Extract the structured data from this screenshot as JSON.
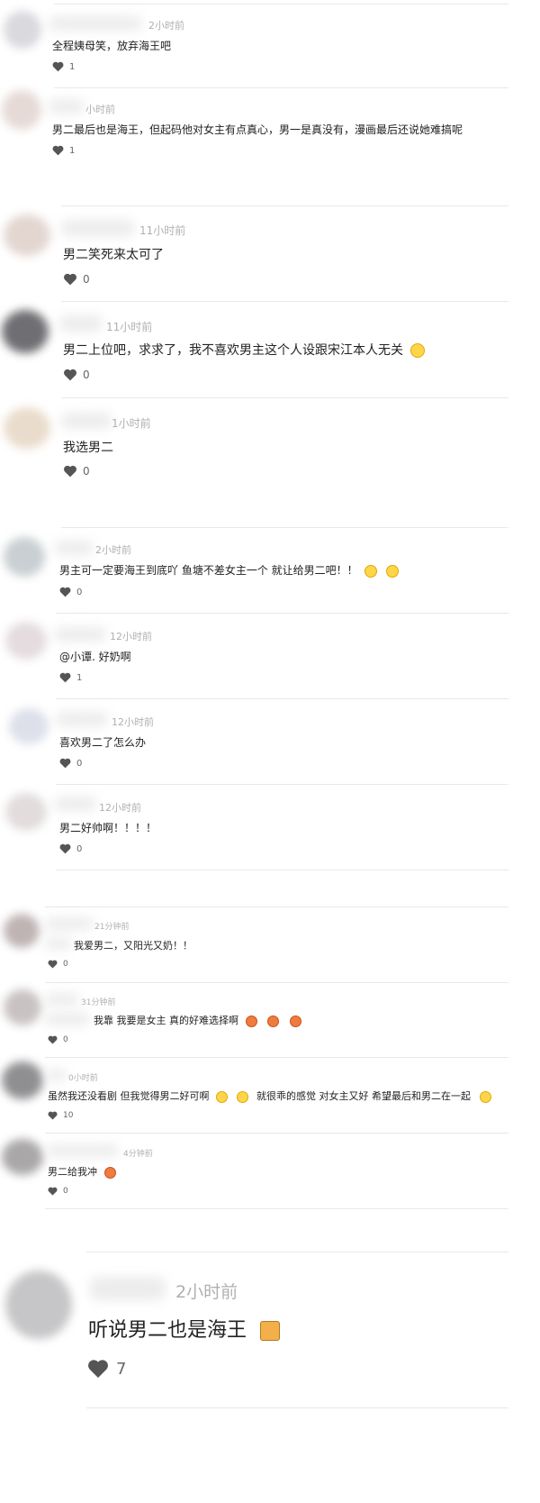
{
  "comments": [
    {
      "time": "2小时前",
      "text": "全程姨母笑，放弃海王吧",
      "likes": "1",
      "avatar_color": "#d9d9de"
    },
    {
      "time": "小时前",
      "text": "男二最后也是海王，但起码他对女主有点真心，男一是真没有，漫画最后还说她难搞呢",
      "likes": "1",
      "avatar_color": "#e6dad6"
    },
    {
      "time": "11小时前",
      "text": "男二笑死来太可了",
      "likes": "0",
      "avatar_color": "#e3d6d0"
    },
    {
      "time": "11小时前",
      "text": "男二上位吧，求求了，我不喜欢男主这个人设跟宋江本人无关",
      "likes": "0",
      "avatar_color": "#6f6f73"
    },
    {
      "time": "1小时前",
      "text": "我选男二",
      "likes": "0",
      "avatar_color": "#eadccc"
    },
    {
      "time": "2小时前",
      "text": "男主可一定要海王到底吖 鱼塘不差女主一个 就让给男二吧！！",
      "likes": "0",
      "avatar_color": "#c9cfd2"
    },
    {
      "time": "12小时前",
      "text": "@小谭. 好奶啊",
      "likes": "1",
      "avatar_color": "#e4dcde"
    },
    {
      "time": "12小时前",
      "text": "喜欢男二了怎么办",
      "likes": "0",
      "avatar_color": "#dde0ea"
    },
    {
      "time": "12小时前",
      "text": "男二好帅啊！！！！",
      "likes": "0",
      "avatar_color": "#e2dcdc"
    },
    {
      "time": "21分钟前",
      "text": "我爱男二，又阳光又奶！！",
      "likes": "0",
      "avatar_color": "#bfb4b4"
    },
    {
      "time": "31分钟前",
      "text": "我靠 我要是女主 真的好难选择啊",
      "likes": "0",
      "avatar_color": "#c9c2c2"
    },
    {
      "time": "0小时前",
      "text": "虽然我还没看剧 但我觉得男二好可啊",
      "text2": "就很乖的感觉 对女主又好 希望最后和男二在一起",
      "likes": "10",
      "avatar_color": "#8f8f92"
    },
    {
      "time": "4分钟前",
      "text": "男二给我冲",
      "likes": "0",
      "avatar_color": "#a9a7a8"
    },
    {
      "time": "2小时前",
      "text": "听说男二也是海王",
      "likes": "7",
      "avatar_color": "#c6c6c8"
    }
  ],
  "icons": {
    "like": "heart-icon",
    "emoji_think": "thinking-face-emoji",
    "emoji_love": "heart-eyes-cat-emoji",
    "emoji_cat": "cat-sticker-emoji"
  }
}
